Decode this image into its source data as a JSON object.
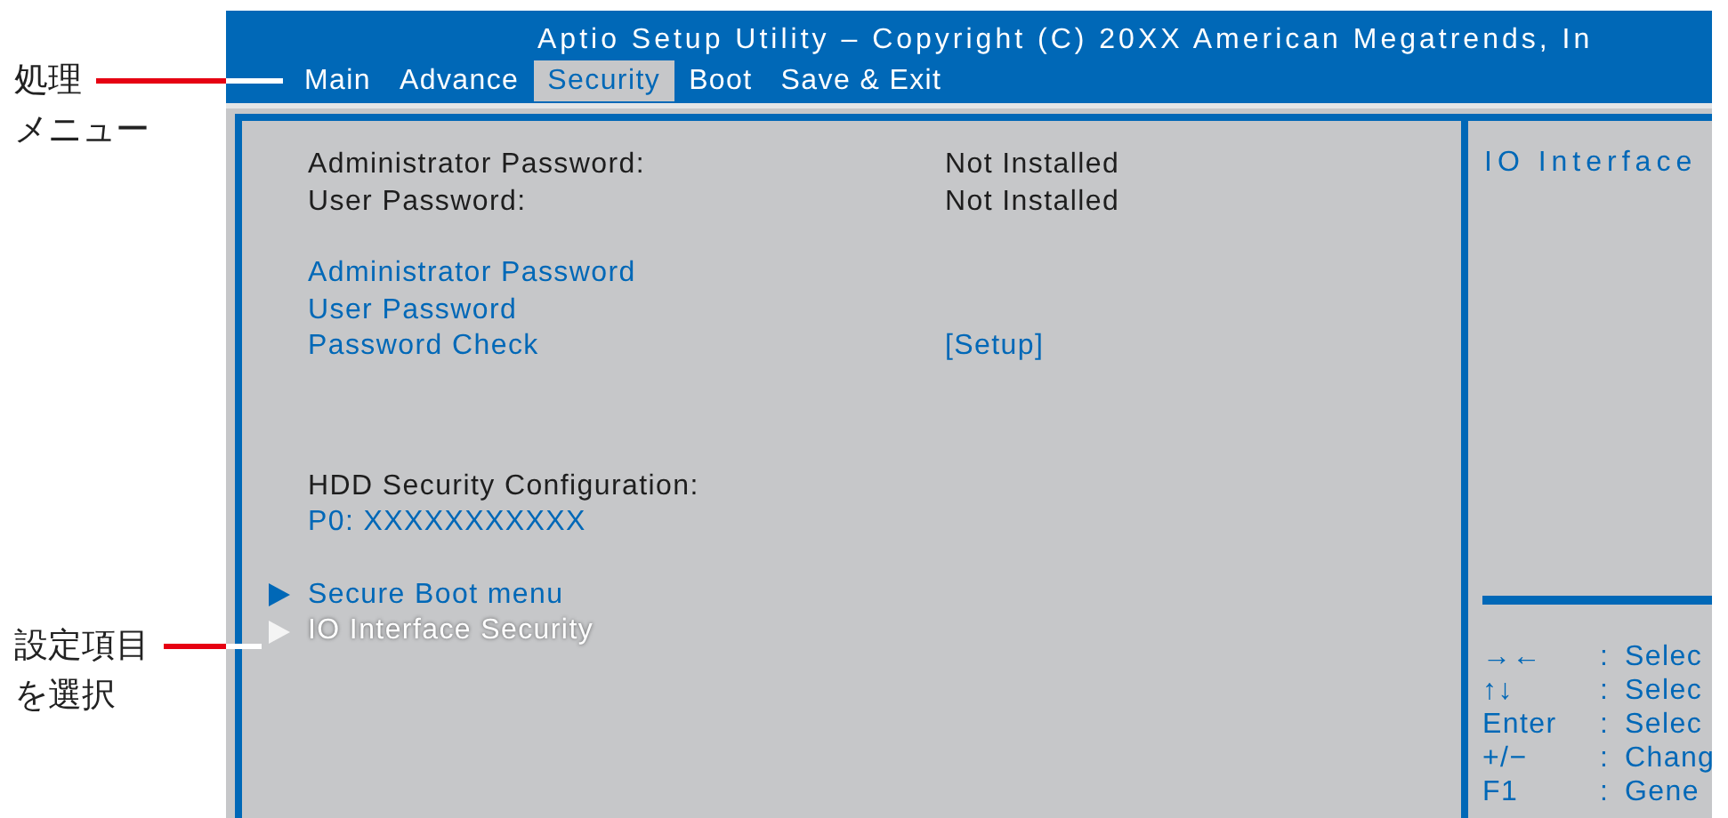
{
  "callouts": [
    {
      "lines": [
        "処理",
        "メニュー"
      ]
    },
    {
      "lines": [
        "設定項目",
        "を選択"
      ]
    }
  ],
  "screen": {
    "title": "Aptio Setup Utility – Copyright (C) 20XX American Megatrends, In",
    "tabs": [
      {
        "label": "Main",
        "selected": false
      },
      {
        "label": "Advance",
        "selected": false
      },
      {
        "label": "Security",
        "selected": true
      },
      {
        "label": "Boot",
        "selected": false
      },
      {
        "label": "Save & Exit",
        "selected": false
      }
    ],
    "groups": [
      [
        {
          "kind": "info",
          "label": "Administrator Password:",
          "value": "Not Installed"
        },
        {
          "kind": "info",
          "label": "User Password:",
          "value": "Not Installed"
        }
      ],
      [
        {
          "kind": "option",
          "label": "Administrator Password"
        },
        {
          "kind": "option",
          "label": "User Password"
        },
        {
          "kind": "option",
          "label": "Password Check",
          "value": "[Setup]"
        }
      ],
      [
        {
          "kind": "info",
          "label": "HDD Security Configuration:"
        },
        {
          "kind": "option",
          "label": "P0: XXXXXXXXXXX"
        }
      ],
      [
        {
          "kind": "submenu",
          "label": "Secure Boot menu",
          "selected": false
        },
        {
          "kind": "submenu",
          "label": "IO Interface Security",
          "selected": true
        }
      ]
    ],
    "help": "IO Interface",
    "keys": [
      {
        "key": "→←",
        "separator": ":",
        "action": "Selec"
      },
      {
        "key": "↑↓",
        "separator": ":",
        "action": "Selec"
      },
      {
        "key": "Enter",
        "separator": ":",
        "action": "Selec"
      },
      {
        "key": "+/−",
        "separator": ":",
        "action": "Chang"
      },
      {
        "key": "F1",
        "separator": ":",
        "action": "Gene"
      }
    ]
  }
}
